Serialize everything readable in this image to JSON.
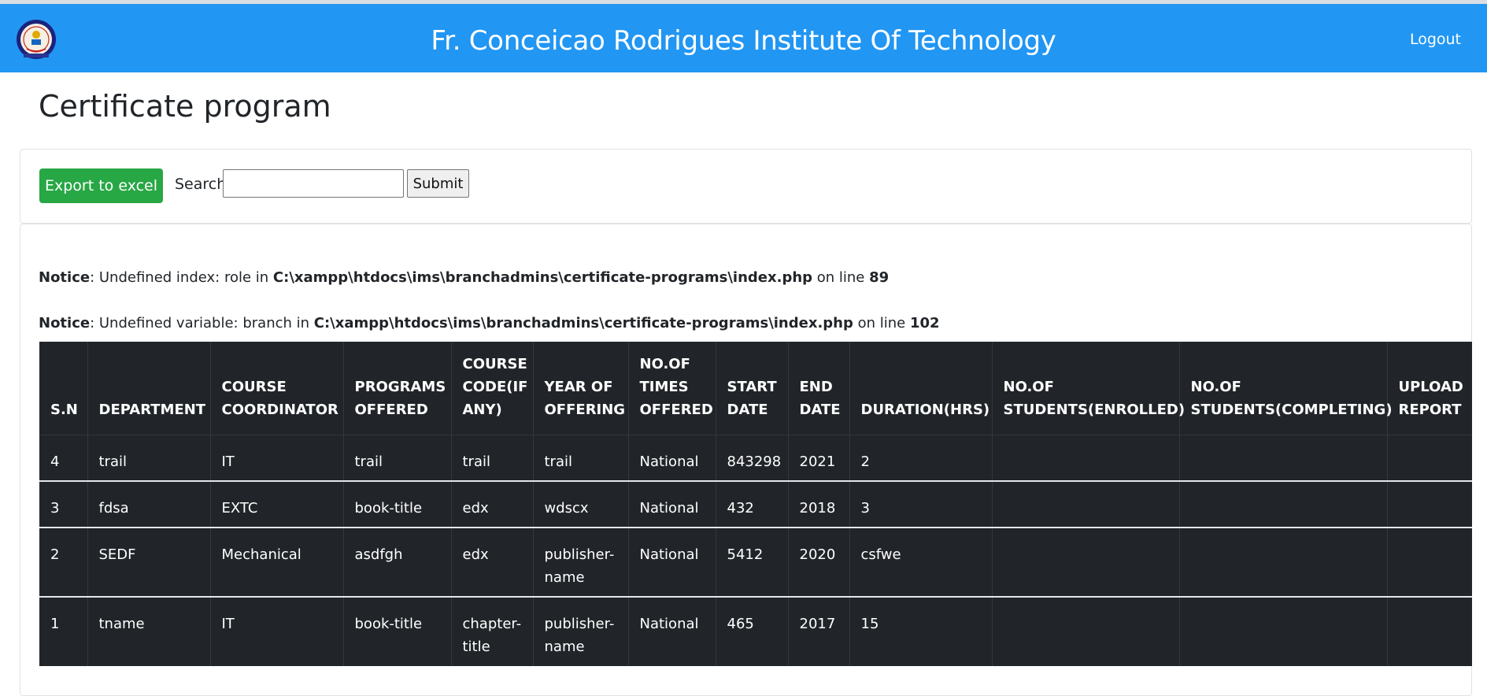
{
  "navbar": {
    "brand": "Fr. Conceicao Rodrigues Institute Of Technology",
    "logout_label": "Logout",
    "logo_icon": "college-seal-icon",
    "bg_color": "#2196f3"
  },
  "page": {
    "title": "Certificate program"
  },
  "toolbar": {
    "export_label": "Export to excel",
    "search_label": "Search",
    "search_value": "",
    "submit_label": "Submit",
    "export_color": "#28a745"
  },
  "notices": [
    {
      "label": "Notice",
      "message": ": Undefined index: role in ",
      "path": "C:\\xampp\\htdocs\\ims\\branchadmins\\certificate-programs\\index.php",
      "on_line": " on line ",
      "line": "89"
    },
    {
      "label": "Notice",
      "message": ": Undefined variable: branch in ",
      "path": "C:\\xampp\\htdocs\\ims\\branchadmins\\certificate-programs\\index.php",
      "on_line": " on line ",
      "line": "102"
    }
  ],
  "table": {
    "columns": [
      "S.N",
      "DEPARTMENT",
      "COURSE COORDINATOR",
      "PROGRAMS OFFERED",
      "COURSE CODE(IF ANY)",
      "YEAR OF OFFERING",
      "NO.OF TIMES OFFERED",
      "START DATE",
      "END DATE",
      "DURATION(HRS)",
      "NO.OF STUDENTS(ENROLLED)",
      "NO.OF STUDENTS(COMPLETING)",
      "UPLOAD REPORT"
    ],
    "rows": [
      [
        "4",
        "trail",
        "IT",
        "trail",
        "trail",
        "trail",
        "National",
        "843298",
        "2021",
        "2",
        "",
        "",
        ""
      ],
      [
        "3",
        "fdsa",
        "EXTC",
        "book-title",
        "edx",
        "wdscx",
        "National",
        "432",
        "2018",
        "3",
        "",
        "",
        ""
      ],
      [
        "2",
        "SEDF",
        "Mechanical",
        "asdfgh",
        "edx",
        "publisher-name",
        "National",
        "5412",
        "2020",
        "csfwe",
        "",
        "",
        ""
      ],
      [
        "1",
        "tname",
        "IT",
        "book-title",
        "chapter-title",
        "publisher-name",
        "National",
        "465",
        "2017",
        "15",
        "",
        "",
        ""
      ]
    ],
    "bg_color": "#212529"
  }
}
